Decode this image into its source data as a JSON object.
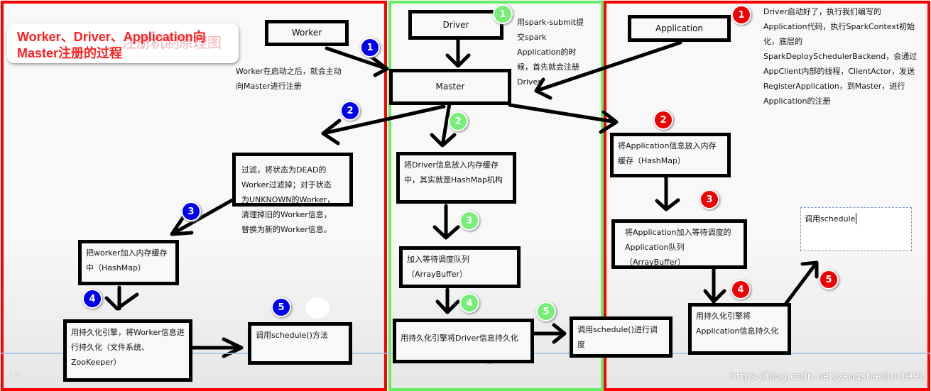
{
  "title": "Worker、Driver、Application向Master注册的过程",
  "watermark_title": "注册机制原理图",
  "slide_number": "16",
  "source_watermark": "https://blog.csdn.net/yangshaojun1992",
  "colors": {
    "worker_badge": "#0000ee",
    "driver_badge": "#77ee77",
    "application_badge": "#ee0000",
    "worker_frame": "#ff0000",
    "driver_frame": "#66ee66",
    "application_frame": "#ff0000"
  },
  "master": {
    "label": "Master"
  },
  "worker": {
    "box_label": "Worker",
    "desc": "Worker在启动之后，就会主动向Master进行注册",
    "step2": "过滤，将状态为DEAD的Worker过滤掉；对于状态为UNKNOWN的Worker，清理掉旧的Worker信息，替换为新的Worker信息。",
    "step3": "把worker加入内存缓存中（HashMap）",
    "step4": "用持久化引擎，将Worker信息进行持久化（文件系统、ZooKeeper）",
    "step5": "调用schedule()方法",
    "badges": [
      "1",
      "2",
      "3",
      "4",
      "5"
    ]
  },
  "driver": {
    "box_label": "Driver",
    "desc": "用spark-submit提交spark Application的时候，首先就会注册Driver",
    "step2": "将Driver信息放入内存缓存中，其实就是HashMap机构",
    "step3": "加入等待调度队列（ArrayBuffer）",
    "step4": "用持久化引擎将Driver信息持久化",
    "step5": "调用schedule()进行调度",
    "badges": [
      "1",
      "2",
      "3",
      "4",
      "5"
    ]
  },
  "application": {
    "box_label": "Application",
    "desc": "Driver启动好了，执行我们编写的Application代码，执行SparkContext初始化，底层的SparkDeploySchedulerBackend，会通过AppClient内部的线程，ClientActor，发送RegisterApplication，到Master，进行Application的注册",
    "step2": "将Application信息放入内存缓存（HashMap）",
    "step3": "将Application加入等待调度的Application队列（ArrayBuffer）",
    "step4": "用持久化引擎将Application信息持久化",
    "step5": "调用schedule",
    "badges": [
      "1",
      "2",
      "3",
      "4",
      "5"
    ]
  }
}
